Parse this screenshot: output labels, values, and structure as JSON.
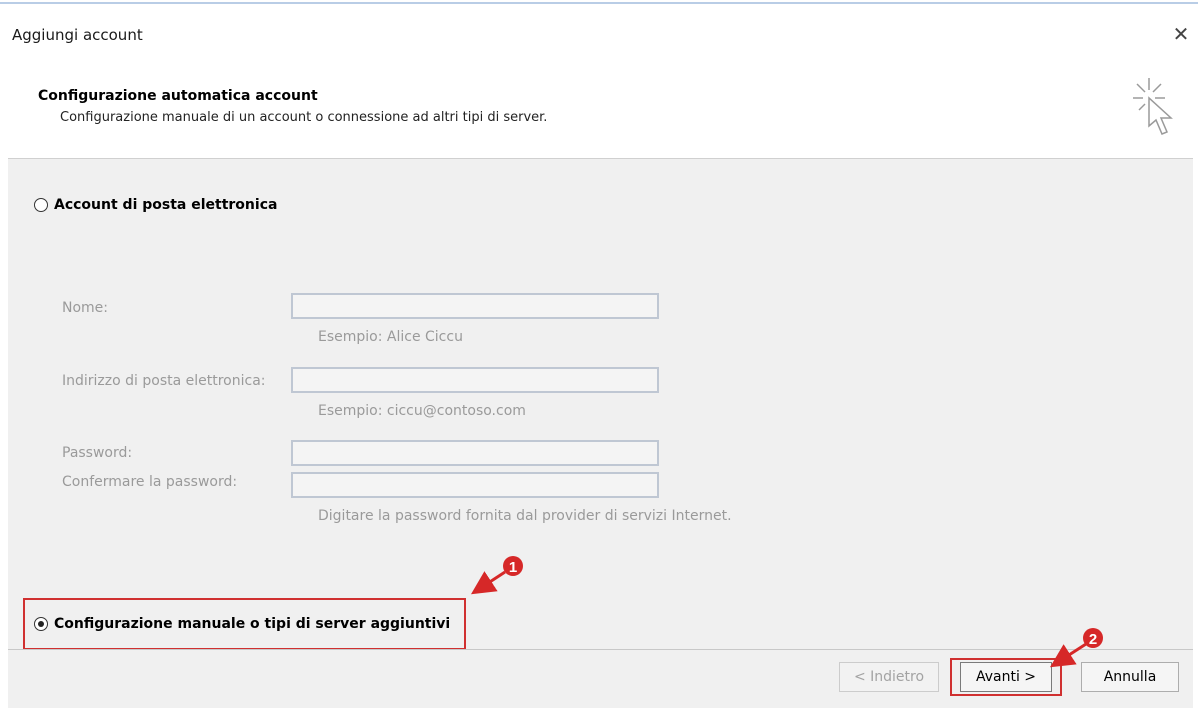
{
  "dialog": {
    "title": "Aggiungi account",
    "close_glyph": "✕"
  },
  "header": {
    "title": "Configurazione automatica account",
    "subtitle": "Configurazione manuale di un account o connessione ad altri tipi di server.",
    "icon": "wizard-cursor-icon"
  },
  "options": {
    "email_account": {
      "label": "Account di posta elettronica",
      "checked": false
    },
    "manual": {
      "label": "Configurazione manuale o tipi di server aggiuntivi",
      "checked": true
    }
  },
  "form": {
    "name": {
      "label": "Nome:",
      "value": "",
      "hint": "Esempio: Alice Ciccu"
    },
    "email": {
      "label": "Indirizzo di posta elettronica:",
      "value": "",
      "hint": "Esempio: ciccu@contoso.com"
    },
    "password": {
      "label": "Password:",
      "value": ""
    },
    "confirm_password": {
      "label": "Confermare la password:",
      "value": "",
      "hint": "Digitare la password fornita dal provider di servizi Internet."
    }
  },
  "buttons": {
    "back": "< Indietro",
    "next": "Avanti >",
    "cancel": "Annulla"
  },
  "annotations": {
    "marker_1": "1",
    "marker_2": "2",
    "color": "#d62828"
  }
}
